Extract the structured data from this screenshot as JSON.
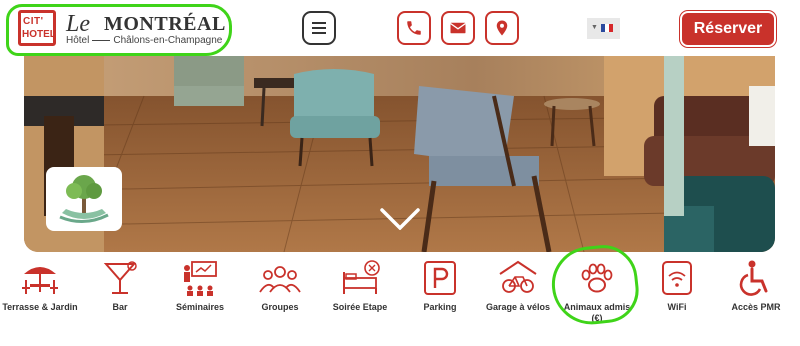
{
  "header": {
    "logo": {
      "badge_line1": "CIT'",
      "badge_line2": "HOTEL",
      "le": "Le",
      "name": "MONTRÉAL",
      "sub_left": "Hôtel",
      "sub_right": "Châlons-en-Champagne"
    },
    "menu_icon": "hamburger-icon",
    "contact_icons": [
      "phone-icon",
      "mail-icon",
      "location-pin-icon"
    ],
    "language_flag": "fr-flag",
    "reserve_label": "Réserver",
    "accent_color": "#c9322b"
  },
  "hero": {
    "scroll_icon": "chevron-down-icon",
    "badge_icon": "eco-tree-hand-icon"
  },
  "amenities": [
    {
      "label": "Terrasse & Jardin",
      "icon": "terrace-umbrella-icon"
    },
    {
      "label": "Bar",
      "icon": "cocktail-icon"
    },
    {
      "label": "Séminaires",
      "icon": "seminar-icon"
    },
    {
      "label": "Groupes",
      "icon": "group-icon"
    },
    {
      "label": "Soirée Etape",
      "icon": "bed-dinner-icon"
    },
    {
      "label": "Parking",
      "icon": "parking-icon"
    },
    {
      "label": "Garage à vélos",
      "icon": "bike-garage-icon"
    },
    {
      "label": "Animaux admis (€)",
      "icon": "paw-icon"
    },
    {
      "label": "WiFi",
      "icon": "wifi-icon"
    },
    {
      "label": "Accès PMR",
      "icon": "wheelchair-icon"
    }
  ]
}
